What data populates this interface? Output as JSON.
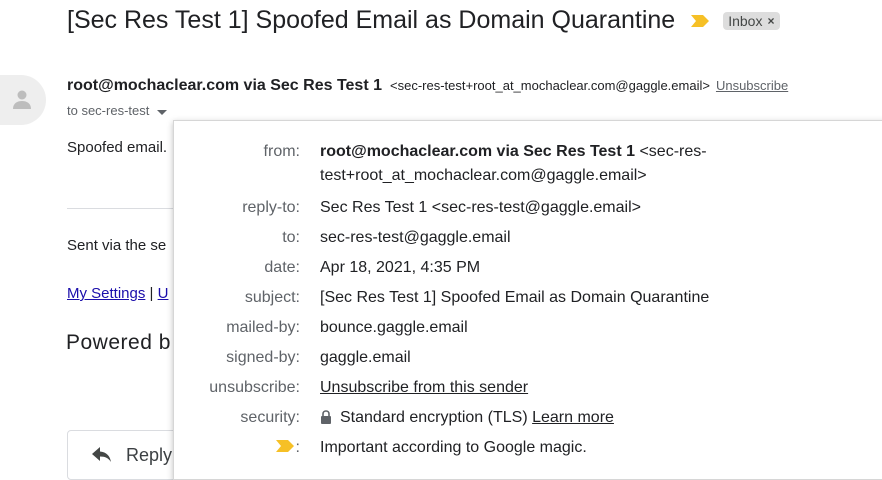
{
  "thread": {
    "subject": "[Sec Res Test 1] Spoofed Email as Domain Quarantine",
    "label_chip": "Inbox",
    "label_remove": "×"
  },
  "header": {
    "sender_name": "root@mochaclear.com via Sec Res Test 1",
    "sender_email": "<sec-res-test+root_at_mochaclear.com@gaggle.email>",
    "unsubscribe": "Unsubscribe",
    "to_label": "to sec-res-test"
  },
  "body": {
    "line1": "Spoofed email.",
    "sent_via": "Sent via the se",
    "my_settings": "My Settings",
    "separator": " | ",
    "second_link": "U",
    "powered": "Powered b"
  },
  "actions": {
    "reply": "Reply"
  },
  "details": {
    "from": {
      "label": "from:",
      "name": "root@mochaclear.com via Sec Res Test 1",
      "email_line1": "<sec-res-",
      "email_line2": "test+root_at_mochaclear.com@gaggle.email>"
    },
    "reply_to": {
      "label": "reply-to:",
      "value": "Sec Res Test 1 <sec-res-test@gaggle.email>"
    },
    "to": {
      "label": "to:",
      "value": "sec-res-test@gaggle.email"
    },
    "date": {
      "label": "date:",
      "value": "Apr 18, 2021, 4:35 PM"
    },
    "subject": {
      "label": "subject:",
      "value": "[Sec Res Test 1] Spoofed Email as Domain Quarantine"
    },
    "mailed_by": {
      "label": "mailed-by:",
      "value": "bounce.gaggle.email"
    },
    "signed_by": {
      "label": "signed-by:",
      "value": "gaggle.email"
    },
    "unsubscribe": {
      "label": "unsubscribe:",
      "value": "Unsubscribe from this sender"
    },
    "security": {
      "label": "security:",
      "value": "Standard encryption (TLS)",
      "link": "Learn more"
    },
    "importance": {
      "label": ":",
      "value": "Important according to Google magic."
    }
  },
  "colors": {
    "importance_marker": "#f6c026",
    "link_blue": "#1a0dab",
    "muted": "#5f6368"
  }
}
